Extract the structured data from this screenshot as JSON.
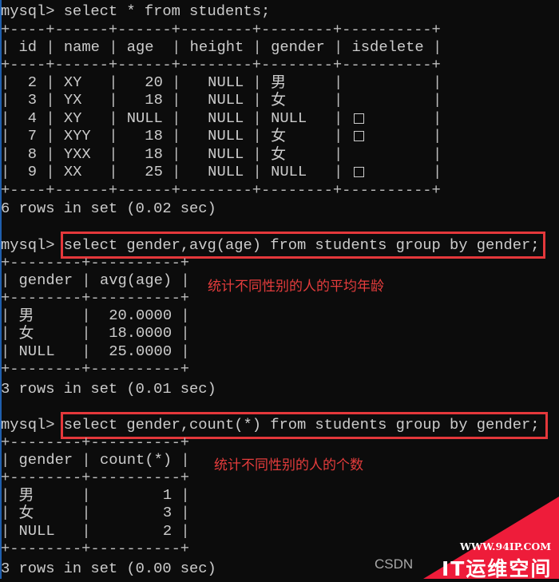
{
  "terminal": {
    "prompt": "mysql> ",
    "queries": [
      {
        "command": "select * from students;",
        "columns": [
          "id",
          "name",
          "age",
          "height",
          "gender",
          "isdelete"
        ],
        "rows": [
          {
            "id": "2",
            "name": "XY",
            "age": "20",
            "height": "NULL",
            "gender": "男",
            "isdelete": ""
          },
          {
            "id": "3",
            "name": "YX",
            "age": "18",
            "height": "NULL",
            "gender": "女",
            "isdelete": ""
          },
          {
            "id": "4",
            "name": "XY",
            "age": "NULL",
            "height": "NULL",
            "gender": "NULL",
            "isdelete": "□"
          },
          {
            "id": "7",
            "name": "XYY",
            "age": "18",
            "height": "NULL",
            "gender": "女",
            "isdelete": "□"
          },
          {
            "id": "8",
            "name": "YXX",
            "age": "18",
            "height": "NULL",
            "gender": "女",
            "isdelete": ""
          },
          {
            "id": "9",
            "name": "XX",
            "age": "25",
            "height": "NULL",
            "gender": "NULL",
            "isdelete": "□"
          }
        ],
        "summary": "6 rows in set (0.02 sec)"
      },
      {
        "command": "select gender,avg(age) from students group by gender;",
        "columns": [
          "gender",
          "avg(age)"
        ],
        "rows": [
          {
            "gender": "男",
            "value": "20.0000"
          },
          {
            "gender": "女",
            "value": "18.0000"
          },
          {
            "gender": "NULL",
            "value": "25.0000"
          }
        ],
        "summary": "3 rows in set (0.01 sec)",
        "annotation": "统计不同性别的人的平均年龄"
      },
      {
        "command": "select gender,count(*) from students group by gender;",
        "columns": [
          "gender",
          "count(*)"
        ],
        "rows": [
          {
            "gender": "男",
            "value": "1"
          },
          {
            "gender": "女",
            "value": "3"
          },
          {
            "gender": "NULL",
            "value": "2"
          }
        ],
        "summary": "3 rows in set (0.00 sec)",
        "annotation": "统计不同性别的人的个数"
      }
    ],
    "borders": {
      "table1": "+----+------+------+--------+--------+----------+",
      "table2": "+--------+----------+",
      "table3": "+--------+----------+"
    }
  },
  "colors": {
    "background": "#0c0c0c",
    "text": "#cccccc",
    "highlight": "#e4383b",
    "annotation": "#e43c3c",
    "watermark": "#ee1c3a"
  },
  "watermark": {
    "url": "WWW.94IP.COM",
    "title": "IT运维空间",
    "source": "CSDN"
  }
}
